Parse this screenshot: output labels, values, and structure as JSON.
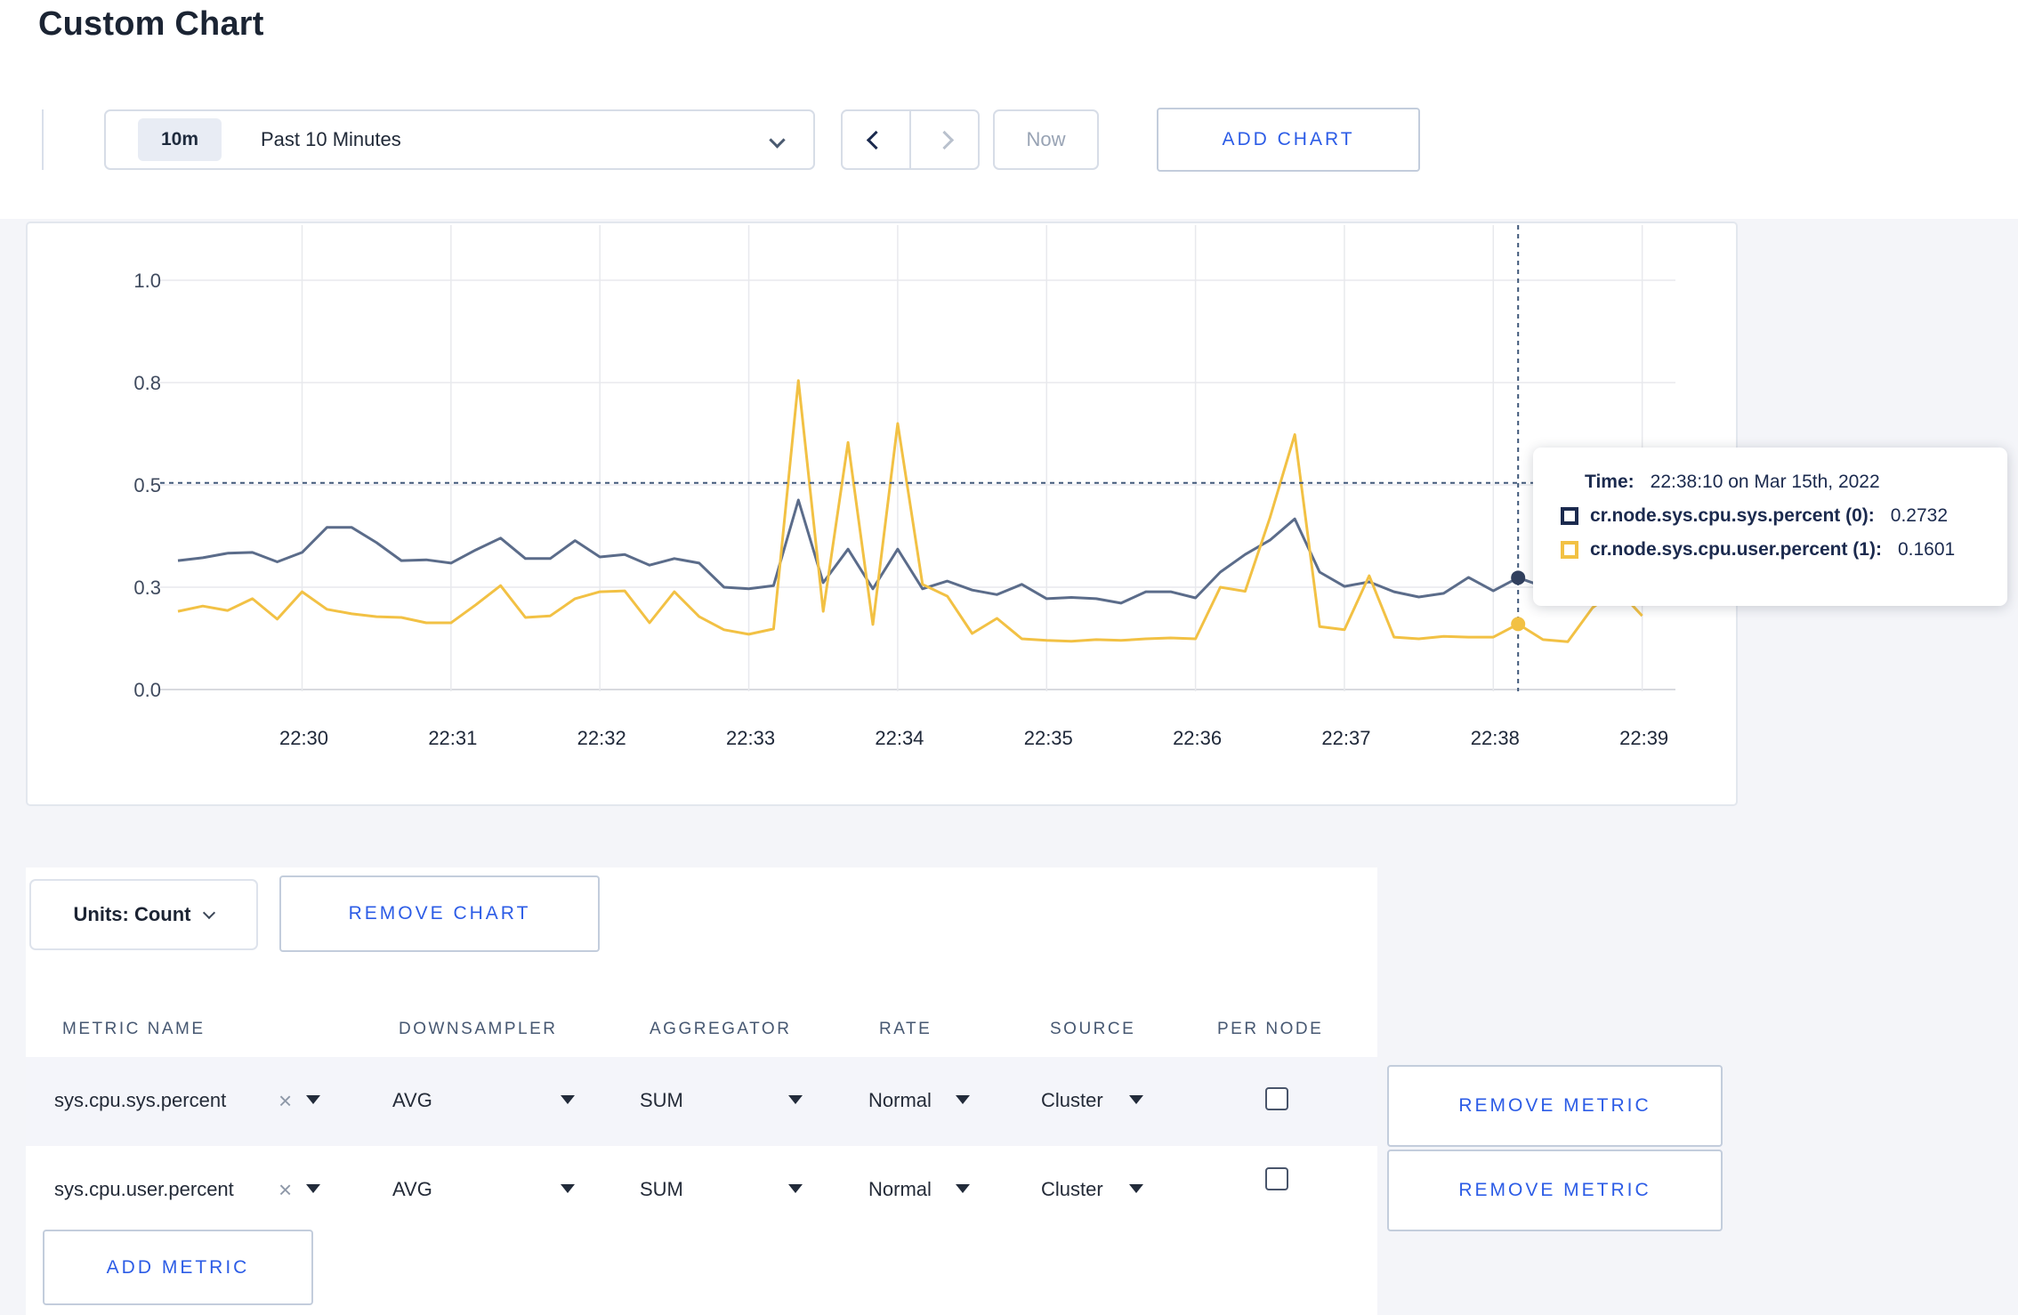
{
  "page": {
    "title": "Custom Chart"
  },
  "toolbar": {
    "range_badge": "10m",
    "range_label": "Past 10 Minutes",
    "now_label": "Now",
    "add_chart_label": "ADD CHART"
  },
  "icons": {
    "timescale_chevron": "chevron-down",
    "prev": "chevron-left",
    "next": "chevron-right",
    "units_chevron": "chevron-down",
    "clear_metric": "×",
    "select_caret": "triangle-down"
  },
  "colors": {
    "accent_blue": "#2c5ce6",
    "series_sys_line": "#5b6c8a",
    "series_user_line": "#f2c144",
    "tooltip_navy": "#1b2a4e",
    "crosshair": "#41597a",
    "grid": "#e8e9ed",
    "row_stripe": "#f4f5fa",
    "page_bg": "#f4f5f9"
  },
  "chart_data": {
    "type": "line",
    "title": "",
    "x_start": "22:29:10",
    "point_interval_sec": 10,
    "x_tick_labels": [
      "22:30",
      "22:31",
      "22:32",
      "22:33",
      "22:34",
      "22:35",
      "22:36",
      "22:37",
      "22:38",
      "22:39"
    ],
    "y_ticks": [
      {
        "value": 1.0,
        "label": "1.0"
      },
      {
        "value": 0.75,
        "label": "0.8"
      },
      {
        "value": 0.5,
        "label": "0.5"
      },
      {
        "value": 0.25,
        "label": "0.3"
      },
      {
        "value": 0.0,
        "label": "0.0"
      }
    ],
    "ylim": [
      0,
      1
    ],
    "grid": true,
    "legend_position": "none",
    "series": [
      {
        "name": "cr.node.sys.cpu.sys.percent",
        "color": "#5b6c8a",
        "values": [
          0.315,
          0.322,
          0.333,
          0.335,
          0.312,
          0.335,
          0.396,
          0.396,
          0.359,
          0.315,
          0.317,
          0.309,
          0.341,
          0.37,
          0.32,
          0.32,
          0.364,
          0.324,
          0.33,
          0.304,
          0.32,
          0.309,
          0.25,
          0.246,
          0.254,
          0.463,
          0.261,
          0.343,
          0.246,
          0.343,
          0.246,
          0.265,
          0.243,
          0.232,
          0.257,
          0.222,
          0.225,
          0.222,
          0.211,
          0.239,
          0.239,
          0.224,
          0.287,
          0.33,
          0.365,
          0.417,
          0.287,
          0.252,
          0.263,
          0.239,
          0.226,
          0.235,
          0.274,
          0.241,
          0.2732,
          0.252,
          0.298,
          0.302,
          0.299,
          0.3
        ]
      },
      {
        "name": "cr.node.sys.cpu.user.percent",
        "color": "#f2c144",
        "values": [
          0.191,
          0.204,
          0.193,
          0.222,
          0.172,
          0.239,
          0.196,
          0.185,
          0.178,
          0.176,
          0.163,
          0.163,
          0.207,
          0.254,
          0.176,
          0.18,
          0.222,
          0.239,
          0.241,
          0.163,
          0.239,
          0.178,
          0.146,
          0.135,
          0.148,
          0.755,
          0.191,
          0.604,
          0.159,
          0.65,
          0.257,
          0.228,
          0.137,
          0.174,
          0.124,
          0.12,
          0.118,
          0.122,
          0.12,
          0.124,
          0.126,
          0.124,
          0.25,
          0.24,
          0.42,
          0.623,
          0.154,
          0.146,
          0.278,
          0.128,
          0.124,
          0.13,
          0.128,
          0.128,
          0.1601,
          0.122,
          0.117,
          0.2,
          0.245,
          0.18
        ]
      }
    ],
    "crosshair": {
      "time": "22:38:10",
      "guide_value": 0.505,
      "point_values": [
        0.2732,
        0.1601
      ],
      "point_colors": [
        "#31405e",
        "#f2c144"
      ]
    }
  },
  "tooltip": {
    "time_label": "Time:",
    "time_value": "22:38:10 on Mar 15th, 2022",
    "series": [
      {
        "label": "cr.node.sys.cpu.sys.percent (0):",
        "value": "0.2732",
        "swatch": "#1b2a4e"
      },
      {
        "label": "cr.node.sys.cpu.user.percent (1):",
        "value": "0.1601",
        "swatch": "#f2c144"
      }
    ]
  },
  "units_bar": {
    "units_label": "Units: Count",
    "remove_chart_label": "REMOVE CHART"
  },
  "table": {
    "headers": [
      "METRIC NAME",
      "DOWNSAMPLER",
      "AGGREGATOR",
      "RATE",
      "SOURCE",
      "PER NODE"
    ],
    "rows": [
      {
        "metric": "sys.cpu.sys.percent",
        "downsampler": "AVG",
        "aggregator": "SUM",
        "rate": "Normal",
        "source": "Cluster",
        "per_node_checked": false,
        "remove_label": "REMOVE METRIC"
      },
      {
        "metric": "sys.cpu.user.percent",
        "downsampler": "AVG",
        "aggregator": "SUM",
        "rate": "Normal",
        "source": "Cluster",
        "per_node_checked": false,
        "remove_label": "REMOVE METRIC"
      }
    ],
    "clear_icon": "×",
    "add_metric_label": "ADD METRIC"
  }
}
